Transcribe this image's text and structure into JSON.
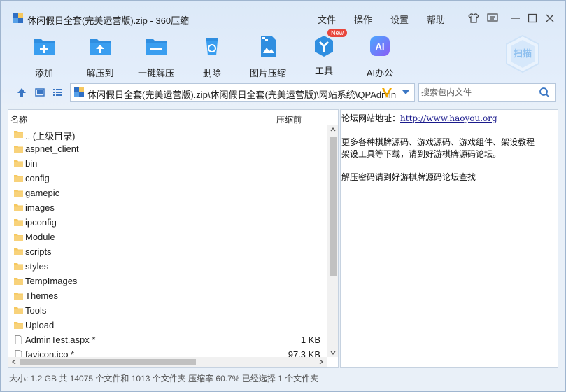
{
  "window": {
    "title": "休闲假日全套(完美运营版).zip - 360压缩",
    "menus": [
      "文件",
      "操作",
      "设置",
      "帮助"
    ]
  },
  "toolbar": {
    "add": "添加",
    "extract_to": "解压到",
    "one_click_extract": "一键解压",
    "delete": "删除",
    "image_compress": "图片压缩",
    "tools": "工具",
    "tools_badge": "New",
    "ai_office": "AI办公",
    "ai_icon_text": "AI",
    "scan": "扫描"
  },
  "address": {
    "path": "休闲假日全套(完美运营版).zip\\休闲假日全套(完美运营版)\\网站系统\\QPAdmin"
  },
  "search": {
    "placeholder": "搜索包内文件"
  },
  "list": {
    "col_name": "名称",
    "col_size": "压缩前",
    "rows": [
      {
        "name": ".. (上级目录)",
        "type": "folder",
        "size": ""
      },
      {
        "name": "aspnet_client",
        "type": "folder",
        "size": ""
      },
      {
        "name": "bin",
        "type": "folder",
        "size": ""
      },
      {
        "name": "config",
        "type": "folder",
        "size": ""
      },
      {
        "name": "gamepic",
        "type": "folder",
        "size": ""
      },
      {
        "name": "images",
        "type": "folder",
        "size": ""
      },
      {
        "name": "ipconfig",
        "type": "folder",
        "size": ""
      },
      {
        "name": "Module",
        "type": "folder",
        "size": ""
      },
      {
        "name": "scripts",
        "type": "folder",
        "size": ""
      },
      {
        "name": "styles",
        "type": "folder",
        "size": ""
      },
      {
        "name": "TempImages",
        "type": "folder",
        "size": ""
      },
      {
        "name": "Themes",
        "type": "folder",
        "size": ""
      },
      {
        "name": "Tools",
        "type": "folder",
        "size": ""
      },
      {
        "name": "Upload",
        "type": "folder",
        "size": ""
      },
      {
        "name": "AdminTest.aspx *",
        "type": "file",
        "size": "1 KB"
      },
      {
        "name": "favicon.ico *",
        "type": "file",
        "size": "97.3 KB"
      }
    ]
  },
  "comment": {
    "forum_label": "论坛网站地址：",
    "forum_url": "http://www.haoyou.org",
    "line2": "更多各种棋牌源码、游戏源码、游戏组件、架设教程",
    "line3": "架设工具等下载，请到好游棋牌源码论坛。",
    "line4": "解压密码请到好游棋牌源码论坛查找"
  },
  "status": {
    "text": "大小: 1.2 GB 共 14075 个文件和 1013 个文件夹 压缩率 60.7% 已经选择 1 个文件夹"
  },
  "colors": {
    "accent": "#2f8ee0",
    "folder": "#f6c85f",
    "badge": "#e8453c"
  }
}
